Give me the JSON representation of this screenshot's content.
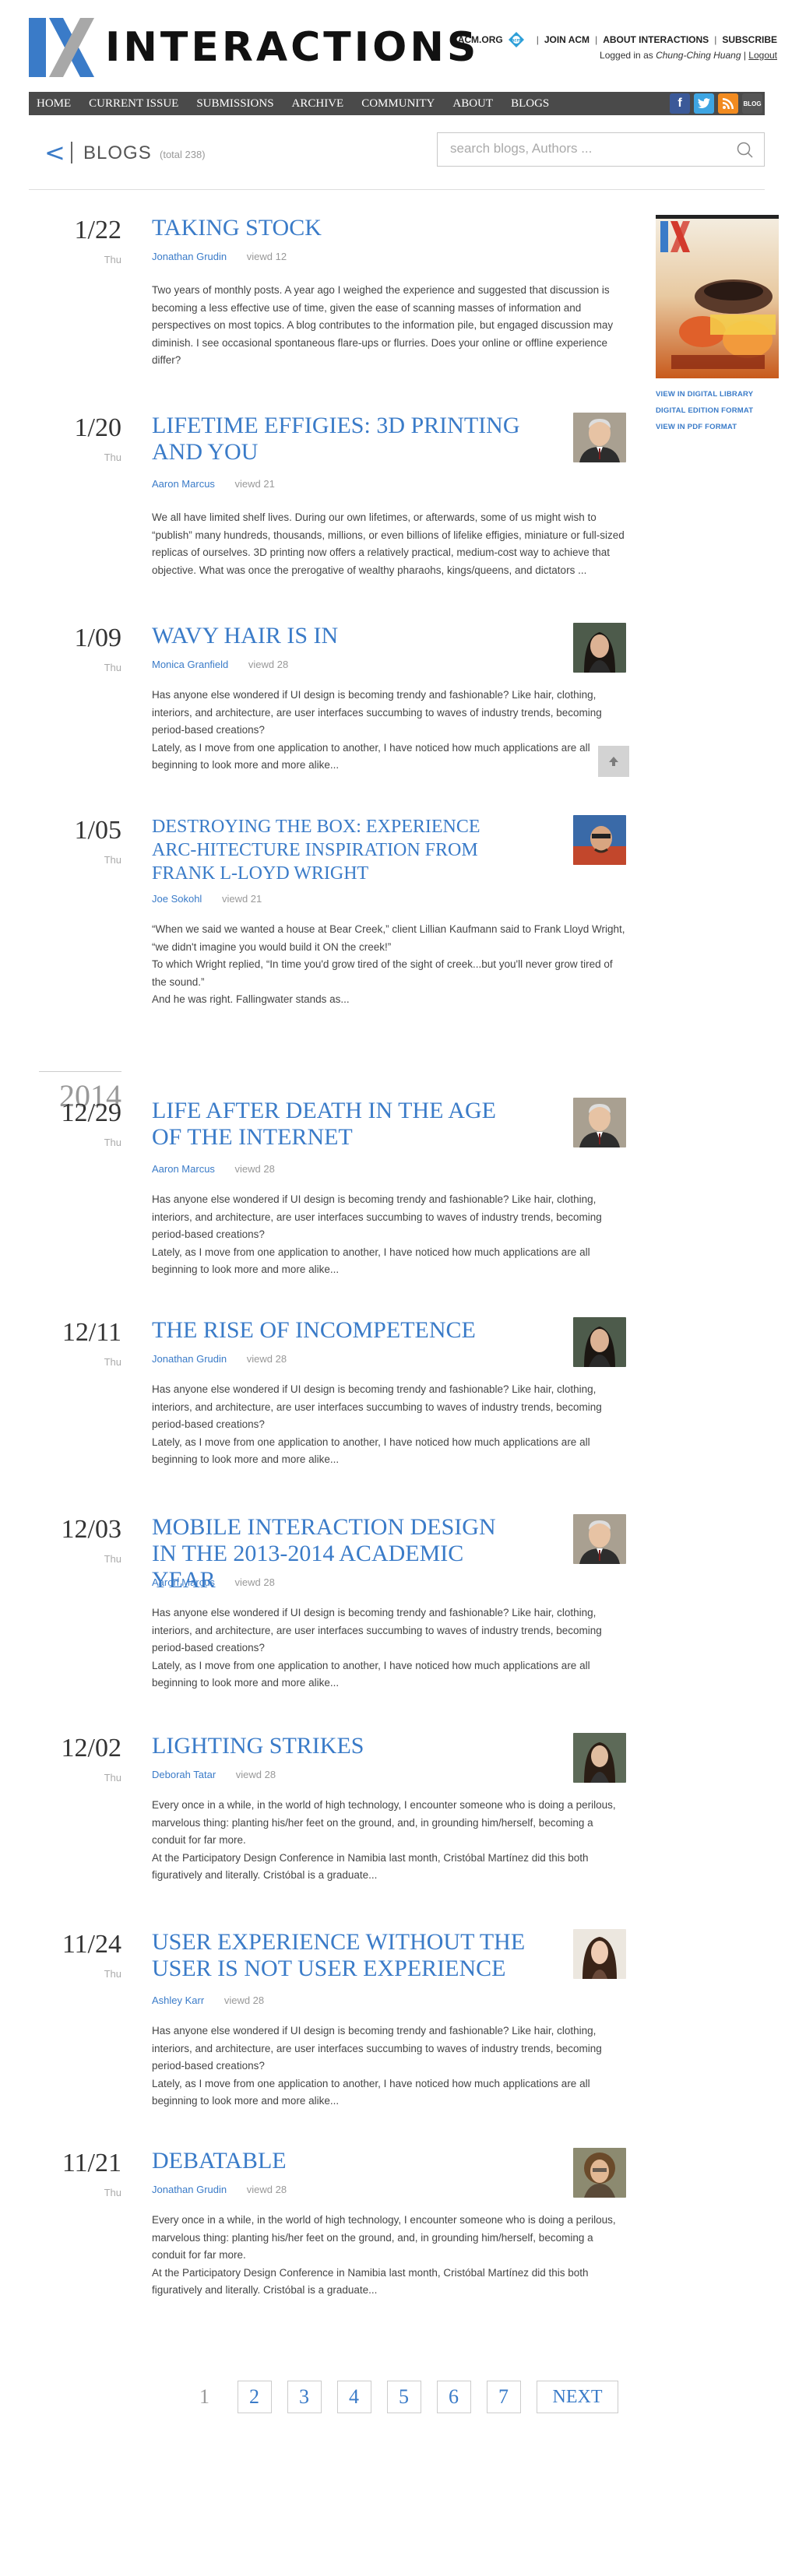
{
  "header": {
    "logo_text": "INTERACTIONS",
    "top_links": [
      "ACM.ORG",
      "JOIN ACM",
      "ABOUT INTERACTIONS",
      "SUBSCRIBE"
    ],
    "logged_in_prefix": "Logged in as",
    "logged_in_user": "Chung-Ching Huang",
    "logout_label": "Logout"
  },
  "nav": {
    "items": [
      "HOME",
      "CURRENT ISSUE",
      "SUBMISSIONS",
      "ARCHIVE",
      "COMMUNITY",
      "ABOUT",
      "BLOGS"
    ],
    "social": [
      "facebook-icon",
      "twitter-icon",
      "rss-icon",
      "blog-icon"
    ],
    "blog_badge": "BLOG"
  },
  "blogs_bar": {
    "back_glyph": "<",
    "title": "BLOGS",
    "total": "(total 238)",
    "search_placeholder": "search blogs, Authors ..."
  },
  "sidebar": {
    "cover_alt": "Interactions magazine cover",
    "links": [
      "VIEW IN DIGITAL LIBRARY",
      "DIGITAL EDITION FORMAT",
      "VIEW IN PDF FORMAT"
    ]
  },
  "year_divider": "2014",
  "posts": [
    {
      "date": "1/22",
      "day": "Thu",
      "title": "TAKING STOCK",
      "author": "Jonathan Grudin",
      "views": "viewd 12",
      "body": [
        "Two years of monthly posts. A year ago I weighed the experience and suggested that discussion is becoming a less effective use of time, given the ease of scanning masses of information and perspectives on most topics. A blog contributes to the information pile, but engaged discussion may diminish. I see occasional spontaneous flare-ups or flurries. Does your online or offline experience differ?"
      ]
    },
    {
      "date": "1/20",
      "day": "Thu",
      "title": "LIFETIME EFFIGIES: 3D PRINTING AND YOU",
      "author": "Aaron Marcus",
      "views": "viewd 21",
      "body": [
        "We all have limited shelf lives. During our own lifetimes, or afterwards, some of us might wish to “publish” many hundreds, thousands, millions, or even billions of lifelike effigies, miniature or full-sized replicas of ourselves. 3D printing now offers a relatively practical, medium-cost way to achieve that objective. What was once the prerogative of wealthy pharaohs, kings/queens, and dictators ..."
      ]
    },
    {
      "date": "1/09",
      "day": "Thu",
      "title": "WAVY HAIR IS IN",
      "author": "Monica Granfield",
      "views": "viewd 28",
      "body": [
        "Has anyone else wondered if UI design is becoming trendy and fashionable? Like hair, clothing, interiors, and architecture, are user interfaces succumbing to waves of industry trends, becoming period-based creations?",
        "Lately, as I move from one application to another, I have noticed how much applications are all beginning to look more and more alike..."
      ]
    },
    {
      "date": "1/05",
      "day": "Thu",
      "title": "DESTROYING THE BOX: EXPERIENCE ARC-HITECTURE INSPIRATION FROM FRANK L-LOYD WRIGHT",
      "author": "Joe Sokohl",
      "views": "viewd 21",
      "body": [
        "“When we said we wanted a house at Bear Creek,” client Lillian Kaufmann said to Frank Lloyd Wright, “we didn't imagine you would build it ON the creek!”",
        "To which Wright replied, “In time you'd grow tired of the sight of creek...but you'll never grow tired of the sound.”",
        "And he was right. Fallingwater stands as..."
      ]
    },
    {
      "date": "12/29",
      "day": "Thu",
      "title": "LIFE AFTER DEATH IN THE AGE OF THE INTERNET",
      "author": "Aaron Marcus",
      "views": "viewd 28",
      "body": [
        "Has anyone else wondered if UI design is becoming trendy and fashionable? Like hair, clothing, interiors, and architecture, are user interfaces succumbing to waves of industry trends, becoming period-based creations?",
        "Lately, as I move from one application to another, I have noticed how much applications are all beginning to look more and more alike..."
      ]
    },
    {
      "date": "12/11",
      "day": "Thu",
      "title": "THE RISE OF INCOMPETENCE",
      "author": "Jonathan Grudin",
      "views": "viewd 28",
      "body": [
        "Has anyone else wondered if UI design is becoming trendy and fashionable? Like hair, clothing, interiors, and architecture, are user interfaces succumbing to waves of industry trends, becoming period-based creations?",
        "Lately, as I move from one application to another, I have noticed how much applications are all beginning to look more and more alike..."
      ]
    },
    {
      "date": "12/03",
      "day": "Thu",
      "title": "MOBILE INTERACTION DESIGN IN THE 2013-2014 ACADEMIC YEAR",
      "author": "Aaron Marcus",
      "views": "viewd 28",
      "body": [
        "Has anyone else wondered if UI design is becoming trendy and fashionable? Like hair, clothing, interiors, and architecture, are user interfaces succumbing to waves of industry trends, becoming period-based creations?",
        "Lately, as I move from one application to another, I have noticed how much applications are all beginning to look more and more alike..."
      ]
    },
    {
      "date": "12/02",
      "day": "Thu",
      "title": "LIGHTING STRIKES",
      "author": "Deborah Tatar",
      "views": "viewd 28",
      "body": [
        "Every once in a while, in the world of high technology, I encounter someone who is doing a perilous, marvelous thing: planting his/her feet on the ground, and, in grounding him/herself, becoming a conduit for far more.",
        "At the Participatory Design Conference in Namibia last month, Cristóbal Martínez did this both figuratively and literally. Cristóbal is a graduate..."
      ]
    },
    {
      "date": "11/24",
      "day": "Thu",
      "title": "USER EXPERIENCE WITHOUT THE USER IS NOT USER EXPERIENCE",
      "author": "Ashley Karr",
      "views": "viewd 28",
      "body": [
        "Has anyone else wondered if UI design is becoming trendy and fashionable? Like hair, clothing, interiors, and architecture, are user interfaces succumbing to waves of industry trends, becoming period-based creations?",
        "Lately, as I move from one application to another, I have noticed how much applications are all beginning to look more and more alike..."
      ]
    },
    {
      "date": "11/21",
      "day": "Thu",
      "title": "DEBATABLE",
      "author": "Jonathan Grudin",
      "views": "viewd 28",
      "body": [
        "Every once in a while, in the world of high technology, I encounter someone who is doing a perilous, marvelous thing: planting his/her feet on the ground, and, in grounding him/herself, becoming a conduit for far more.",
        "At the Participatory Design Conference in Namibia last month, Cristóbal Martínez did this both figuratively and literally. Cristóbal is a graduate..."
      ]
    }
  ],
  "pagination": {
    "pages": [
      "1",
      "2",
      "3",
      "4",
      "5",
      "6",
      "7"
    ],
    "current": "1",
    "next_label": "NEXT"
  },
  "colors": {
    "accent": "#3a7bc8",
    "nav_bg": "#4a4a4a"
  }
}
